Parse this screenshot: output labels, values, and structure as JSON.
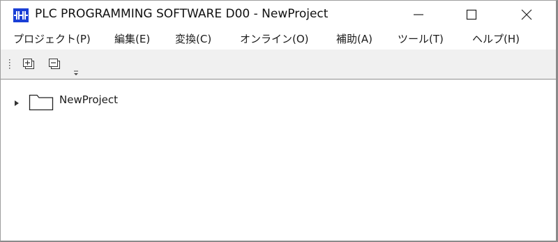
{
  "window": {
    "title": "PLC PROGRAMMING SOFTWARE D00  - NewProject",
    "app_icon": "plc-app-icon",
    "controls": [
      "minimize-icon",
      "maximize-icon",
      "close-icon"
    ],
    "accent_color": "#1a3fd6"
  },
  "menu": {
    "items": [
      {
        "label": "プロジェクト(P)"
      },
      {
        "label": "編集(E)"
      },
      {
        "label": "変換(C)"
      },
      {
        "label": "オンライン(O)"
      },
      {
        "label": "補助(A)"
      },
      {
        "label": "ツール(T)"
      },
      {
        "label": "ヘルプ(H)"
      }
    ]
  },
  "toolbar": {
    "buttons": [
      "expand-all-icon",
      "collapse-all-icon"
    ],
    "overflow": "overflow-chevron-icon"
  },
  "tree": {
    "nodes": [
      {
        "label": "NewProject",
        "icon": "folder-icon",
        "expanded": false
      }
    ]
  }
}
